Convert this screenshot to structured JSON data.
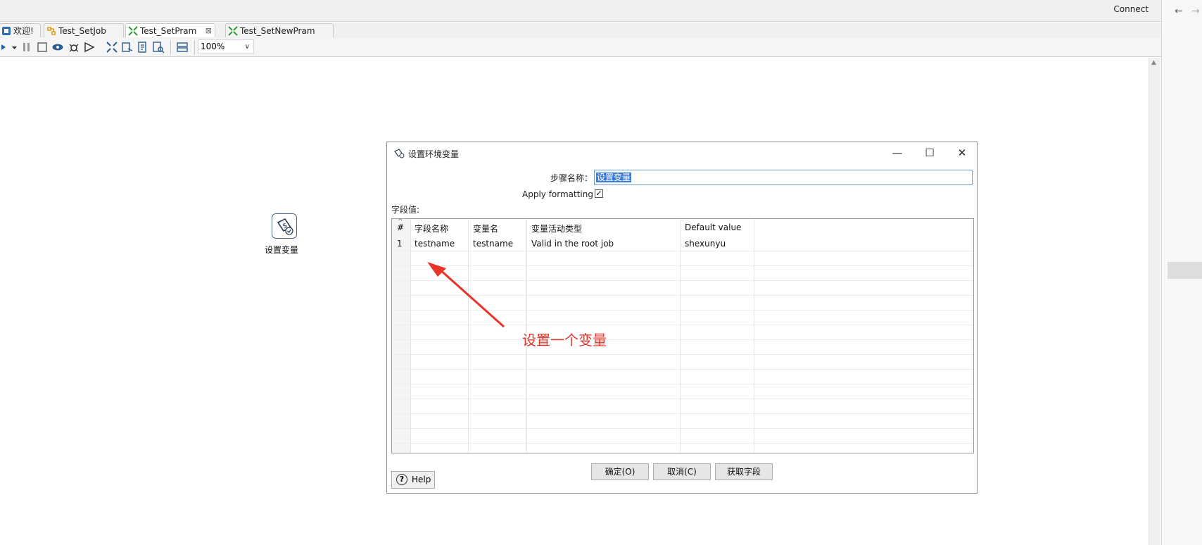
{
  "topbar": {
    "connect_label": "Connect"
  },
  "tabs": [
    {
      "label": "欢迎!",
      "icon": "welcome-icon"
    },
    {
      "label": "Test_SetJob",
      "icon": "job-icon"
    },
    {
      "label": "Test_SetPram",
      "icon": "transformation-icon",
      "active": true
    },
    {
      "label": "Test_SetNewPram",
      "icon": "transformation-icon"
    }
  ],
  "toolbar": {
    "zoom_value": "100%"
  },
  "canvas": {
    "step_label": "设置变量"
  },
  "dialog": {
    "title": "设置环境变量",
    "step_name_label": "步骤名称：",
    "step_name_value": "设置变量",
    "apply_formatting_label": "Apply formatting",
    "apply_formatting_checked": true,
    "fields_label": "字段值:",
    "table": {
      "columns": [
        "#",
        "字段名称",
        "变量名",
        "变量活动类型",
        "Default value"
      ],
      "rows": [
        [
          "1",
          "testname",
          "testname",
          "Valid in the root job",
          "shexunyu"
        ]
      ]
    },
    "buttons": {
      "ok": "确定(O)",
      "cancel": "取消(C)",
      "get_fields": "获取字段",
      "help": "Help"
    }
  },
  "annotation": {
    "text": "设置一个变量",
    "color": "#e8342b"
  }
}
